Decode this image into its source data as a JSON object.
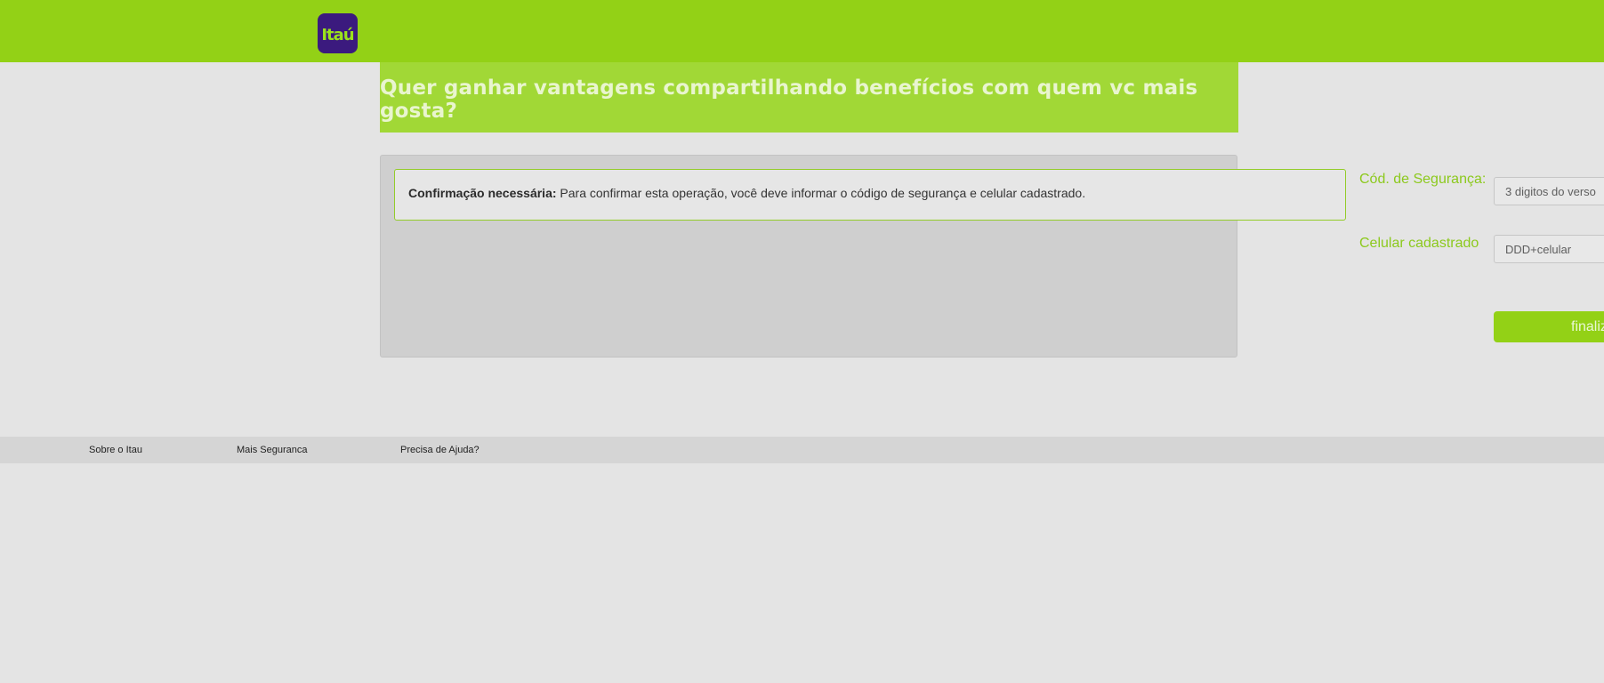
{
  "header": {
    "logo_text": "Itaú"
  },
  "banner": {
    "text": "Quer ganhar vantagens compartilhando benefícios com quem vc mais gosta?"
  },
  "alert": {
    "title": "Confirmação necessária:",
    "message": "Para confirmar esta operação, você deve informar o código de segurança e celular cadastrado."
  },
  "form": {
    "security_code_label": "Cód. de Segurança:",
    "security_code_placeholder": "3 digitos do verso",
    "phone_label": "Celular cadastrado",
    "phone_placeholder": "DDD+celular",
    "submit_label": "finaliz"
  },
  "footer": {
    "links": [
      "Sobre o Itau",
      "Mais Seguranca",
      "Precisa de Ajuda?"
    ]
  },
  "colors": {
    "brand_green": "#93d116",
    "logo_purple": "#3b1a7e"
  }
}
